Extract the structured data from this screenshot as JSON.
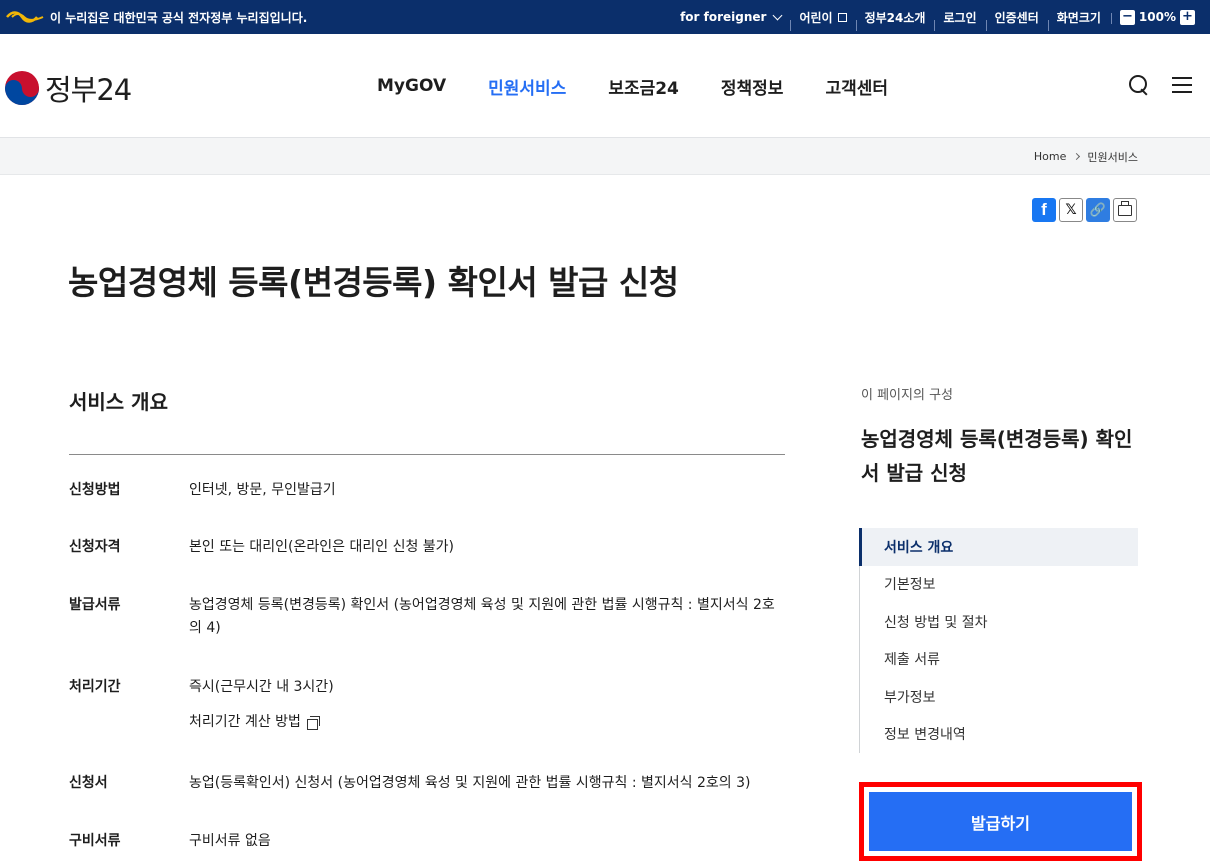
{
  "gov_banner": {
    "notice": "이 누리집은 대한민국 공식 전자정부 누리집입니다.",
    "links": [
      "for foreigner",
      "어린이",
      "정부24소개",
      "로그인",
      "인증센터"
    ],
    "zoom_label": "화면크기",
    "zoom_minus": "−",
    "zoom_value": "100%",
    "zoom_plus": "+"
  },
  "header": {
    "logo_text": "정부24",
    "nav": [
      "MyGOV",
      "민원서비스",
      "보조금24",
      "정책정보",
      "고객센터"
    ],
    "active_nav": "민원서비스"
  },
  "breadcrumb": [
    "Home",
    "민원서비스"
  ],
  "share": {
    "facebook": "f",
    "x": "𝕏",
    "link": "🔗"
  },
  "page_title": "농업경영체 등록(변경등록) 확인서 발급 신청",
  "main": {
    "section_title": "서비스 개요",
    "rows": [
      {
        "key": "신청방법",
        "value": "인터넷, 방문, 무인발급기"
      },
      {
        "key": "신청자격",
        "value": "본인 또는 대리인(온라인은 대리인 신청 불가)"
      },
      {
        "key": "발급서류",
        "value": "농업경영체 등록(변경등록) 확인서 (농어업경영체 육성 및 지원에 관한 법률 시행규칙 : 별지서식 2호의 4)"
      },
      {
        "key": "처리기간",
        "value": "즉시(근무시간 내 3시간)",
        "link": "처리기간 계산 방법"
      },
      {
        "key": "신청서",
        "value": "농업(등록확인서) 신청서 (농어업경영체 육성 및 지원에 관한 법률 시행규칙 : 별지서식 2호의 3)"
      },
      {
        "key": "구비서류",
        "value": "구비서류 없음"
      }
    ]
  },
  "sidebar": {
    "caption": "이 페이지의 구성",
    "title": "농업경영체 등록(변경등록) 확인서 발급 신청",
    "toc": [
      "서비스 개요",
      "기본정보",
      "신청 방법 및 절차",
      "제출 서류",
      "부가정보",
      "정보 변경내역"
    ],
    "issue_button": "발급하기"
  },
  "colors": {
    "banner": "#0b2f6b",
    "accent": "#256ef4",
    "highlight": "#ff0000"
  }
}
